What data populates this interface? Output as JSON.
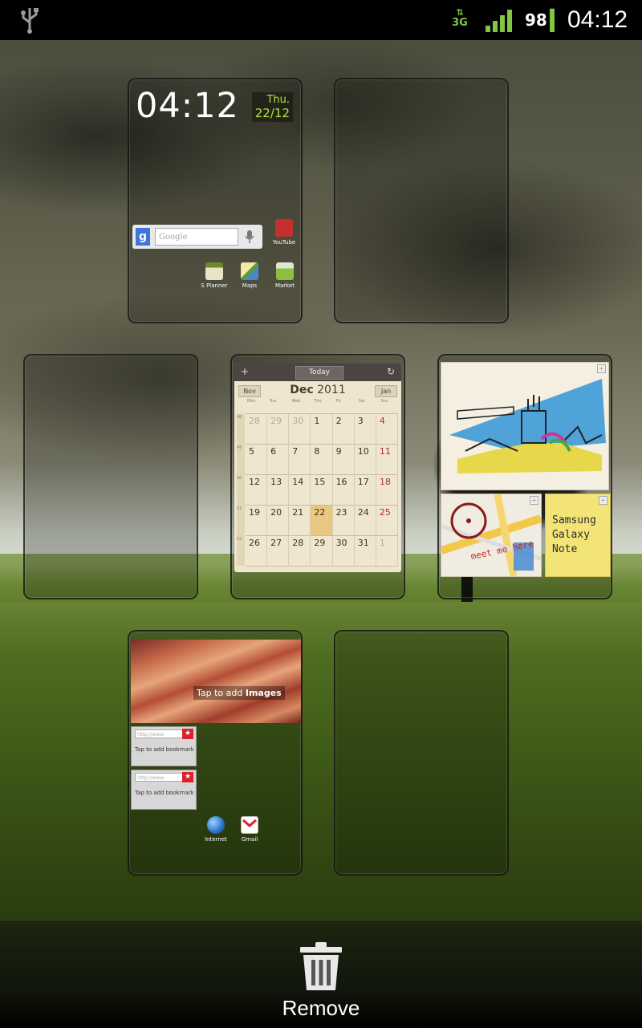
{
  "status_bar": {
    "usb_icon": "usb-icon",
    "network_type": "3G",
    "battery_level": 0.98,
    "battery_text": "98",
    "time": "04:12",
    "accent_color": "#7dc742"
  },
  "panel1": {
    "clock_widget": {
      "time": "04:12",
      "day": "Thu.",
      "date": "22/12"
    },
    "search": {
      "placeholder": "Google",
      "logo": "g"
    },
    "apps": [
      {
        "label": "YouTube",
        "icon": "youtube-icon"
      },
      {
        "label": "S Planner",
        "icon": "s-planner-icon"
      },
      {
        "label": "Maps",
        "icon": "maps-icon"
      },
      {
        "label": "Market",
        "icon": "market-icon"
      }
    ]
  },
  "calendar": {
    "today_button": "Today",
    "prev_month": "Nov",
    "next_month": "Jan",
    "month": "Dec",
    "year": "2011",
    "weekdays": [
      "Mon",
      "Tue",
      "Wed",
      "Thu",
      "Fri",
      "Sat",
      "Sun"
    ],
    "week_label": "W",
    "weeks": [
      "48",
      "49",
      "50",
      "51",
      "52"
    ],
    "days": [
      [
        "28",
        "29",
        "30",
        "1",
        "2",
        "3",
        "4"
      ],
      [
        "5",
        "6",
        "7",
        "8",
        "9",
        "10",
        "11"
      ],
      [
        "12",
        "13",
        "14",
        "15",
        "16",
        "17",
        "18"
      ],
      [
        "19",
        "20",
        "21",
        "22",
        "23",
        "24",
        "25"
      ],
      [
        "26",
        "27",
        "28",
        "29",
        "30",
        "31",
        "1"
      ]
    ],
    "today": "22"
  },
  "memo": {
    "note_text": "Samsung Galaxy Note",
    "map_label": "meet me here"
  },
  "panel6": {
    "image_widget": {
      "caption_prefix": "Tap to add ",
      "caption_bold": "Images"
    },
    "bookmarks": [
      {
        "url_placeholder": "http://www",
        "label": "Tap to add bookmark"
      },
      {
        "url_placeholder": "http://www",
        "label": "Tap to add bookmark"
      }
    ],
    "apps": [
      {
        "label": "Internet",
        "icon": "internet-icon"
      },
      {
        "label": "Gmail",
        "icon": "gmail-icon"
      }
    ]
  },
  "bottom_bar": {
    "remove_label": "Remove",
    "icon": "trash-icon"
  }
}
